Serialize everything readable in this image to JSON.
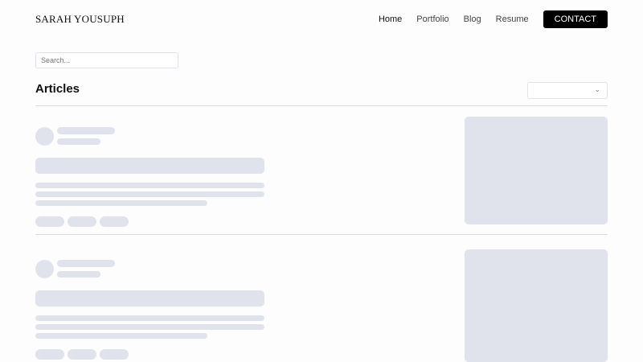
{
  "header": {
    "logo": "SARAH YOUSUPH",
    "nav": [
      "Home",
      "Portfolio",
      "Blog",
      "Resume"
    ],
    "contact": "CONTACT"
  },
  "search": {
    "placeholder": "Search..."
  },
  "main": {
    "title": "Articles",
    "sort_select_value": "",
    "chevron": "⌄"
  }
}
